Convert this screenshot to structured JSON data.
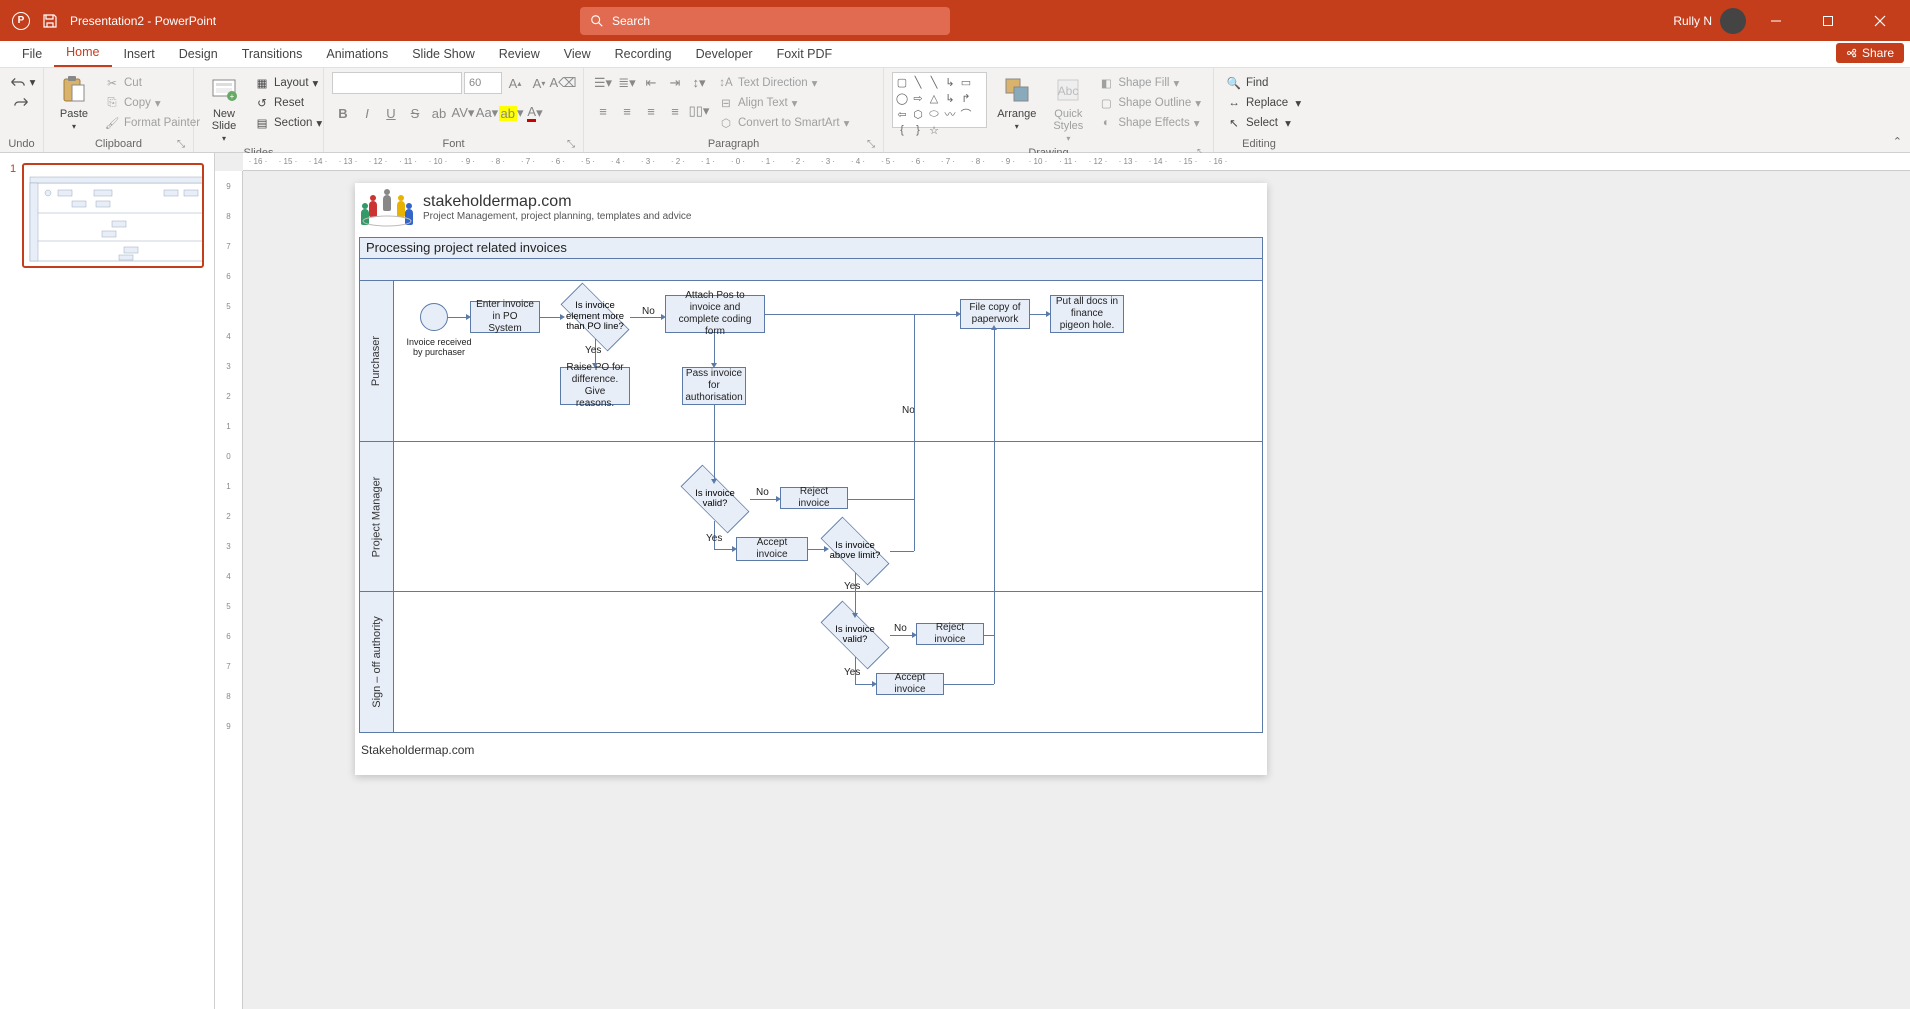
{
  "titlebar": {
    "doc_name": "Presentation2",
    "app_suffix": " - PowerPoint",
    "search_placeholder": "Search",
    "user_name": "Rully N"
  },
  "tabs": {
    "file": "File",
    "home": "Home",
    "insert": "Insert",
    "design": "Design",
    "transitions": "Transitions",
    "animations": "Animations",
    "slideshow": "Slide Show",
    "review": "Review",
    "view": "View",
    "recording": "Recording",
    "developer": "Developer",
    "foxit": "Foxit PDF",
    "share": "Share"
  },
  "ribbon": {
    "undo": "Undo",
    "clipboard": {
      "paste": "Paste",
      "cut": "Cut",
      "copy": "Copy",
      "format_painter": "Format Painter",
      "label": "Clipboard"
    },
    "slides": {
      "new_slide": "New\nSlide",
      "layout": "Layout",
      "reset": "Reset",
      "section": "Section",
      "label": "Slides"
    },
    "font": {
      "size": "60",
      "label": "Font"
    },
    "paragraph": {
      "text_direction": "Text Direction",
      "align_text": "Align Text",
      "convert_smartart": "Convert to SmartArt",
      "label": "Paragraph"
    },
    "drawing": {
      "arrange": "Arrange",
      "quick_styles": "Quick\nStyles",
      "shape_fill": "Shape Fill",
      "shape_outline": "Shape Outline",
      "shape_effects": "Shape Effects",
      "label": "Drawing"
    },
    "editing": {
      "find": "Find",
      "replace": "Replace",
      "select": "Select",
      "label": "Editing"
    }
  },
  "thumb": {
    "number": "1"
  },
  "slide": {
    "logo_title": "stakeholdermap.com",
    "logo_sub": "Project Management, project planning, templates and advice",
    "header": "Processing project related invoices",
    "lanes": {
      "purchaser": "Purchaser",
      "pm": "Project Manager",
      "signoff": "Sign – off authority"
    },
    "nodes": {
      "invoice_received": "Invoice received by purchaser",
      "enter_invoice": "Enter invoice in PO System",
      "is_element_more": "Is invoice element more than PO line?",
      "attach_pos": "Attach Pos to invoice and complete coding form",
      "file_copy": "File copy of paperwork",
      "put_docs": "Put all docs in finance pigeon hole.",
      "raise_po": "Raise PO for difference. Give reasons.",
      "pass_invoice": "Pass invoice for authorisation",
      "is_valid_pm": "Is invoice valid?",
      "reject_pm": "Reject invoice",
      "accept_pm": "Accept invoice",
      "above_limit": "Is invoice above limit?",
      "is_valid_so": "Is invoice valid?",
      "reject_so": "Reject invoice",
      "accept_so": "Accept invoice"
    },
    "labels": {
      "no": "No",
      "yes": "Yes"
    },
    "footer": "Stakeholdermap.com"
  },
  "ruler": {
    "h": [
      "16",
      "15",
      "14",
      "13",
      "12",
      "11",
      "10",
      "9",
      "8",
      "7",
      "6",
      "5",
      "4",
      "3",
      "2",
      "1",
      "0",
      "1",
      "2",
      "3",
      "4",
      "5",
      "6",
      "7",
      "8",
      "9",
      "10",
      "11",
      "12",
      "13",
      "14",
      "15",
      "16"
    ],
    "v": [
      "9",
      "8",
      "7",
      "6",
      "5",
      "4",
      "3",
      "2",
      "1",
      "0",
      "1",
      "2",
      "3",
      "4",
      "5",
      "6",
      "7",
      "8",
      "9"
    ]
  }
}
